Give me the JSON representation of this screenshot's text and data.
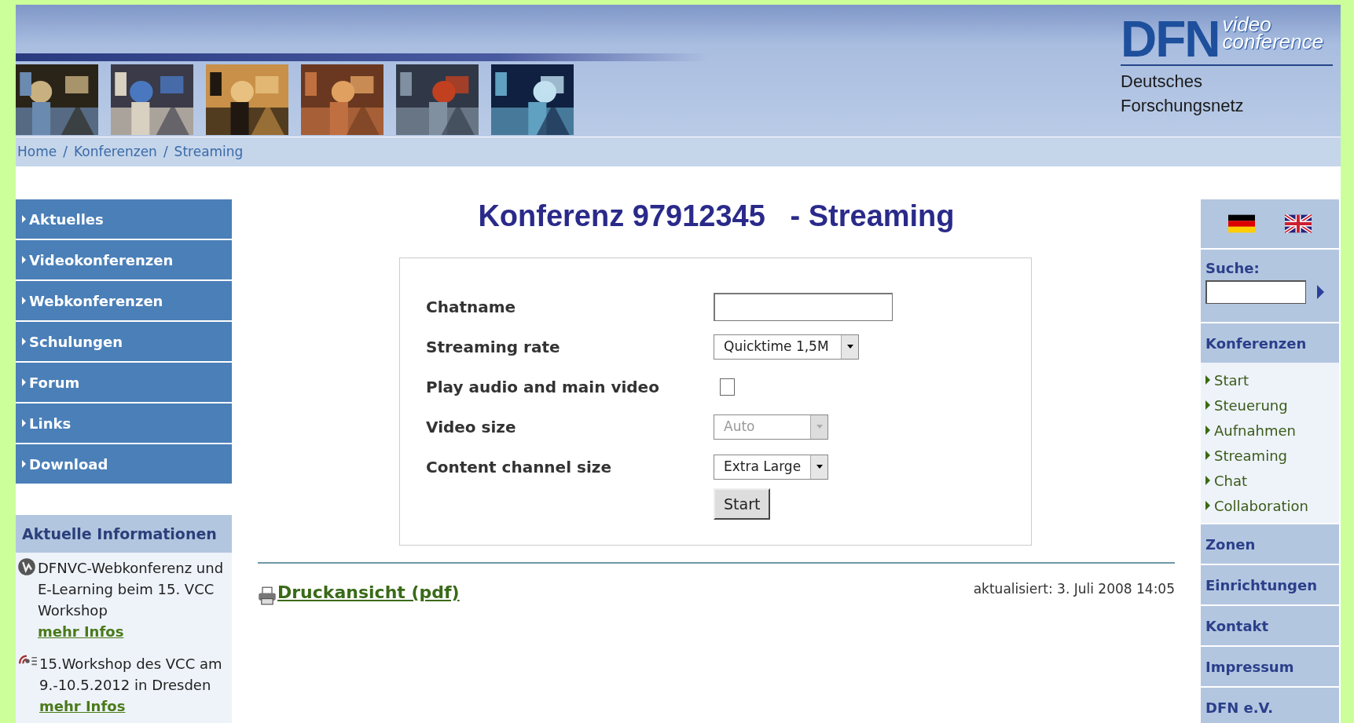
{
  "header": {
    "logo": {
      "brand": "DFN",
      "tagline_1": "video",
      "tagline_2": "conference",
      "org_line_1": "Deutsches",
      "org_line_2": "Forschungsnetz"
    }
  },
  "breadcrumb": [
    {
      "label": "Home",
      "separator": "/"
    },
    {
      "label": "Konferenzen",
      "separator": "/"
    },
    {
      "label": "Streaming"
    }
  ],
  "left_nav": [
    "Aktuelles",
    "Videokonferenzen",
    "Webkonferenzen",
    "Schulungen",
    "Forum",
    "Links",
    "Download"
  ],
  "info_panel": {
    "title": "Aktuelle Informationen",
    "items": [
      {
        "kind": "webconference",
        "text": "DFNVC-Webkonferenz und E-Learning beim 15. VCC Workshop",
        "link": "mehr Infos"
      },
      {
        "kind": "workshop",
        "text": "15.Workshop des VCC am 9.-10.5.2012 in Dresden",
        "link": "mehr Infos"
      }
    ]
  },
  "page_title": "Konferenz 97912345   - Streaming",
  "form": {
    "rows": [
      {
        "kind": "text",
        "label": "Chatname"
      },
      {
        "kind": "select",
        "label": "Streaming rate",
        "value": "Quicktime 1,5M",
        "disabled": false
      },
      {
        "kind": "checkbox",
        "label": "Play audio and main video",
        "checked": false
      },
      {
        "kind": "select",
        "label": "Video size",
        "value": "Auto",
        "disabled": true
      },
      {
        "kind": "select",
        "label": "Content channel size",
        "value": "Extra Large",
        "disabled": false
      }
    ],
    "button": "Start"
  },
  "footer": {
    "print_link": "Druckansicht (pdf)",
    "updated": "aktualisiert: 3. Juli 2008 14:05"
  },
  "right_sidebar": {
    "search_label": "Suche:",
    "sections": [
      {
        "label": "Konferenzen",
        "children": [
          "Start",
          "Steuerung",
          "Aufnahmen",
          "Streaming",
          "Chat",
          "Collaboration"
        ]
      },
      {
        "label": "Zonen"
      },
      {
        "label": "Einrichtungen"
      },
      {
        "label": "Kontakt"
      },
      {
        "label": "Impressum"
      },
      {
        "label": "DFN e.V."
      }
    ]
  }
}
